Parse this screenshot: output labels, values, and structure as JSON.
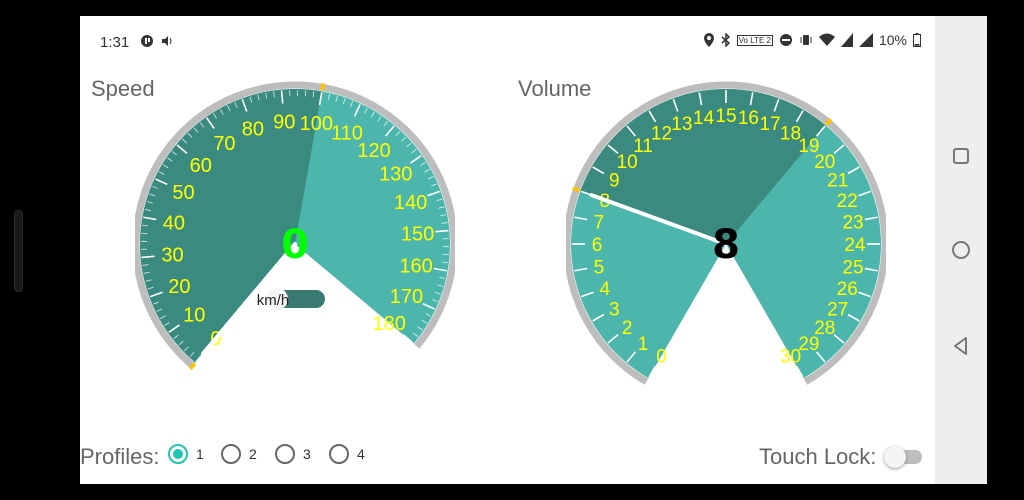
{
  "status_bar": {
    "time": "1:31",
    "battery": "10%",
    "left_icons": [
      "app-notification-icon",
      "volume-icon"
    ],
    "right_icons": [
      "location-icon",
      "bluetooth-icon",
      "volte-icon",
      "do-not-disturb-icon",
      "vibrate-icon",
      "wifi-icon",
      "signal-icon",
      "battery-icon"
    ],
    "volte_text": "Vo LTE 2"
  },
  "speed_gauge": {
    "label": "Speed",
    "value": 0,
    "display_value": "0",
    "unit": "km/h",
    "min": 0,
    "max": 180,
    "active_max": 100,
    "ticks": [
      "0",
      "10",
      "20",
      "30",
      "40",
      "50",
      "60",
      "70",
      "80",
      "90",
      "100",
      "110",
      "120",
      "130",
      "140",
      "150",
      "160",
      "170",
      "180"
    ],
    "colors": {
      "dark_fill": "#3a8a80",
      "light_fill": "#4db6ac",
      "text": "#ffff00",
      "value_text": "#00ff00",
      "rim": "#bdbdbd",
      "marker": "#ffc107"
    }
  },
  "volume_gauge": {
    "label": "Volume",
    "value": 8,
    "display_value": "8",
    "min": 0,
    "max": 30,
    "active_min": 8,
    "active_max": 19,
    "ticks": [
      "0",
      "1",
      "2",
      "3",
      "4",
      "5",
      "6",
      "7",
      "8",
      "9",
      "10",
      "11",
      "12",
      "13",
      "14",
      "15",
      "16",
      "17",
      "18",
      "19",
      "20",
      "21",
      "22",
      "23",
      "24",
      "25",
      "26",
      "27",
      "28",
      "29",
      "30"
    ],
    "colors": {
      "dark_fill": "#3a8a80",
      "light_fill": "#4db6ac",
      "text": "#ffff00",
      "value_text": "#000000",
      "rim": "#bdbdbd",
      "marker": "#ffc107"
    }
  },
  "footer": {
    "profiles_label": "Profiles:",
    "profiles": [
      "1",
      "2",
      "3",
      "4"
    ],
    "selected_profile": "1",
    "touch_lock_label": "Touch Lock:",
    "touch_lock_on": false
  },
  "nav": [
    "recents-icon",
    "home-icon",
    "back-icon"
  ]
}
